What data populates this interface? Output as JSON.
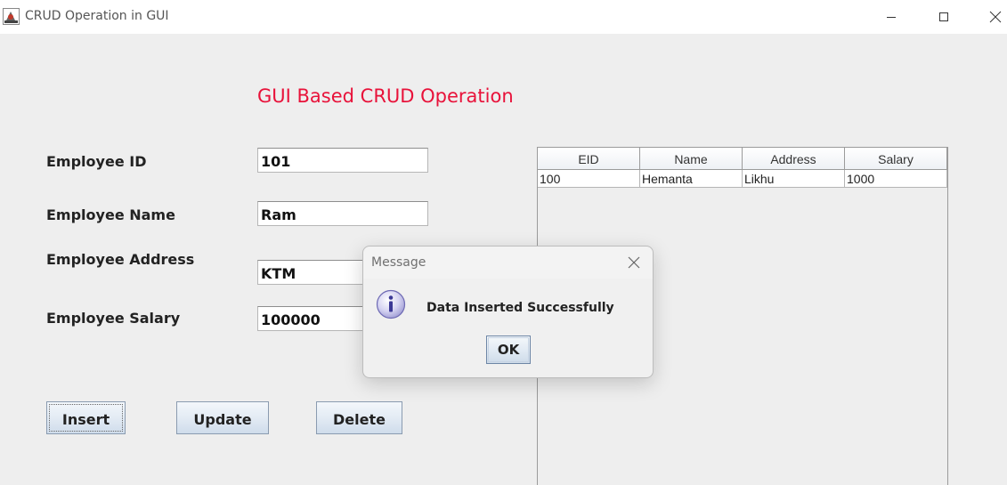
{
  "window": {
    "title": "CRUD Operation in GUI"
  },
  "form": {
    "heading": "GUI Based CRUD Operation",
    "fields": [
      {
        "label": "Employee ID",
        "value": "101"
      },
      {
        "label": "Employee Name",
        "value": "Ram"
      },
      {
        "label": "Employee Address",
        "value": "KTM"
      },
      {
        "label": "Employee Salary",
        "value": "100000"
      }
    ],
    "buttons": {
      "insert": "Insert",
      "update": "Update",
      "delete": "Delete"
    }
  },
  "table": {
    "columns": [
      "EID",
      "Name",
      "Address",
      "Salary"
    ],
    "rows": [
      [
        "100",
        "Hemanta",
        "Likhu",
        "1000"
      ]
    ]
  },
  "dialog": {
    "title": "Message",
    "message": "Data Inserted Successfully",
    "ok_label": "OK",
    "icon": "info-icon"
  },
  "colors": {
    "heading": "#e8123a",
    "background": "#eeeeee"
  }
}
